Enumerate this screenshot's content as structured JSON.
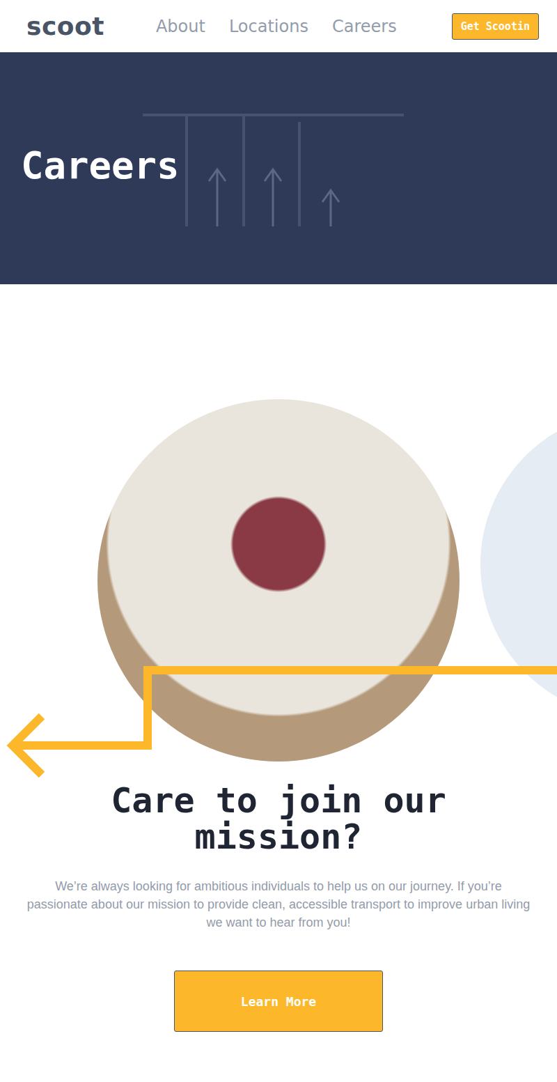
{
  "header": {
    "logo": "scoot",
    "links": [
      "About",
      "Locations",
      "Careers"
    ],
    "cta": "Get Scootin"
  },
  "hero": {
    "title": "Careers"
  },
  "mission": {
    "heading": "Care to join our mission?",
    "text": "We’re always looking for ambitious individuals to help us on our journey. If you’re passionate about our mission to provide clean, accessible transport to improve urban living we want to hear from you!",
    "button": "Learn More"
  }
}
